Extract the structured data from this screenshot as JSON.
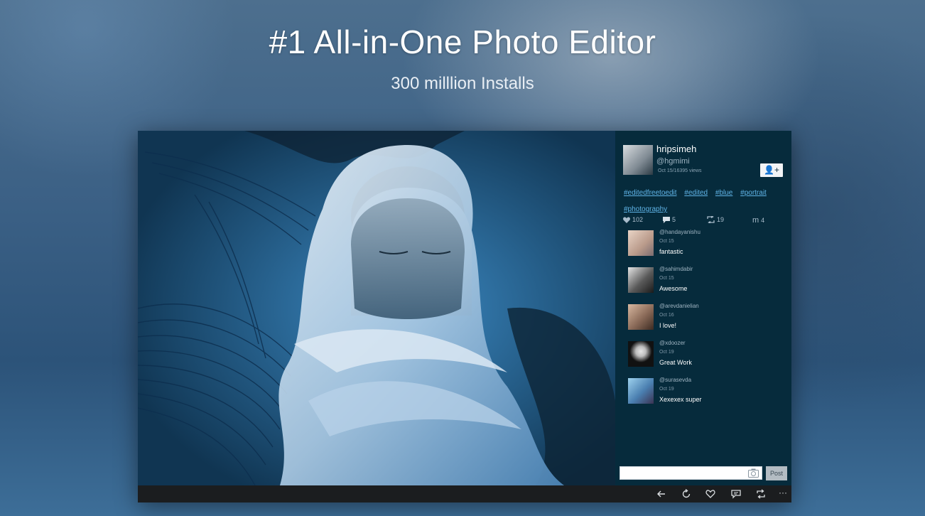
{
  "hero": {
    "title": "#1 All-in-One Photo Editor",
    "subtitle": "300 milllion Installs"
  },
  "post": {
    "author": {
      "name": "hripsimeh",
      "handle": "@hgmimi",
      "meta": "Oct 15/16395 views"
    },
    "follow_icon": "add-user-icon",
    "follow_label": "👤+",
    "tags": [
      "#editedfreetoedit",
      "#edited",
      "#blue",
      "#portrait",
      "#photography"
    ],
    "stats": {
      "likes": "102",
      "comments": "5",
      "reposts": "19",
      "remixes": "4"
    },
    "comments": [
      {
        "user": "@handayanishu",
        "date": "Oct 15",
        "text": "fantastic"
      },
      {
        "user": "@sahimdabir",
        "date": "Oct 15",
        "text": "Awesome"
      },
      {
        "user": "@arevdanielian",
        "date": "Oct 16",
        "text": "I love!"
      },
      {
        "user": "@xdoozer",
        "date": "Oct 19",
        "text": "Great Work"
      },
      {
        "user": "@surasevda",
        "date": "Oct 19",
        "text": "Xexexex super"
      }
    ],
    "comment_input": {
      "value": "",
      "placeholder": ""
    },
    "post_button": "Post"
  },
  "toolbar": {
    "icons": [
      "back-icon",
      "refresh-icon",
      "heart-icon",
      "comment-icon",
      "repost-icon",
      "more-icon"
    ],
    "more_label": "···"
  },
  "colors": {
    "panel_bg": "#062b3c",
    "tag_link": "#5fb3e6",
    "bottom_bar": "#1b1d1f"
  }
}
